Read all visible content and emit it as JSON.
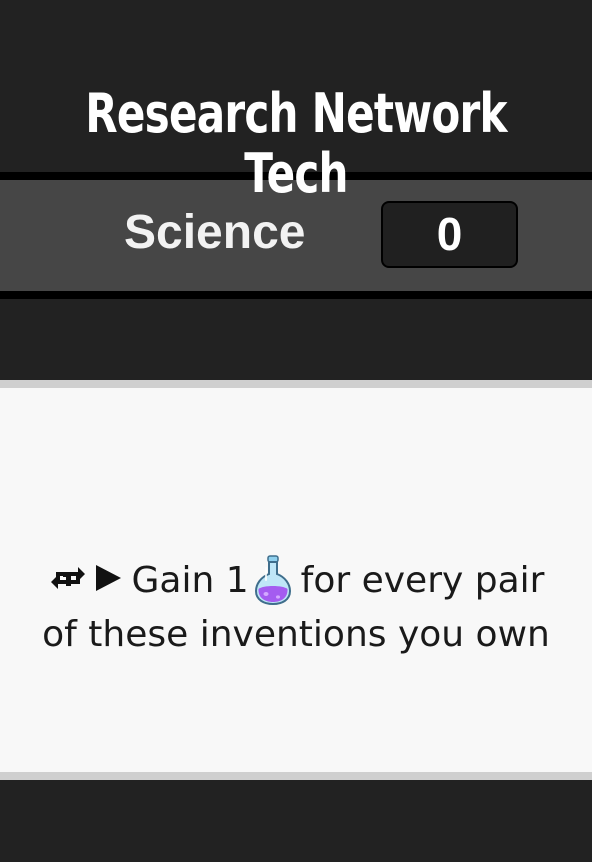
{
  "card": {
    "title": "Research Network Tech"
  },
  "resource": {
    "label": "Science",
    "value": "0"
  },
  "effect": {
    "text_before": "Gain 1",
    "text_after": "for every pair of these inventions you own",
    "icons": [
      "repeat-once-icon",
      "play-arrow-icon",
      "potion-flask-icon"
    ]
  },
  "colors": {
    "background": "#222222",
    "band": "#464646",
    "card": "#f8f8f8",
    "card_border": "#cfcfcf",
    "flask_liquid": "#a45cf0",
    "flask_glass": "#7fc8ea"
  }
}
